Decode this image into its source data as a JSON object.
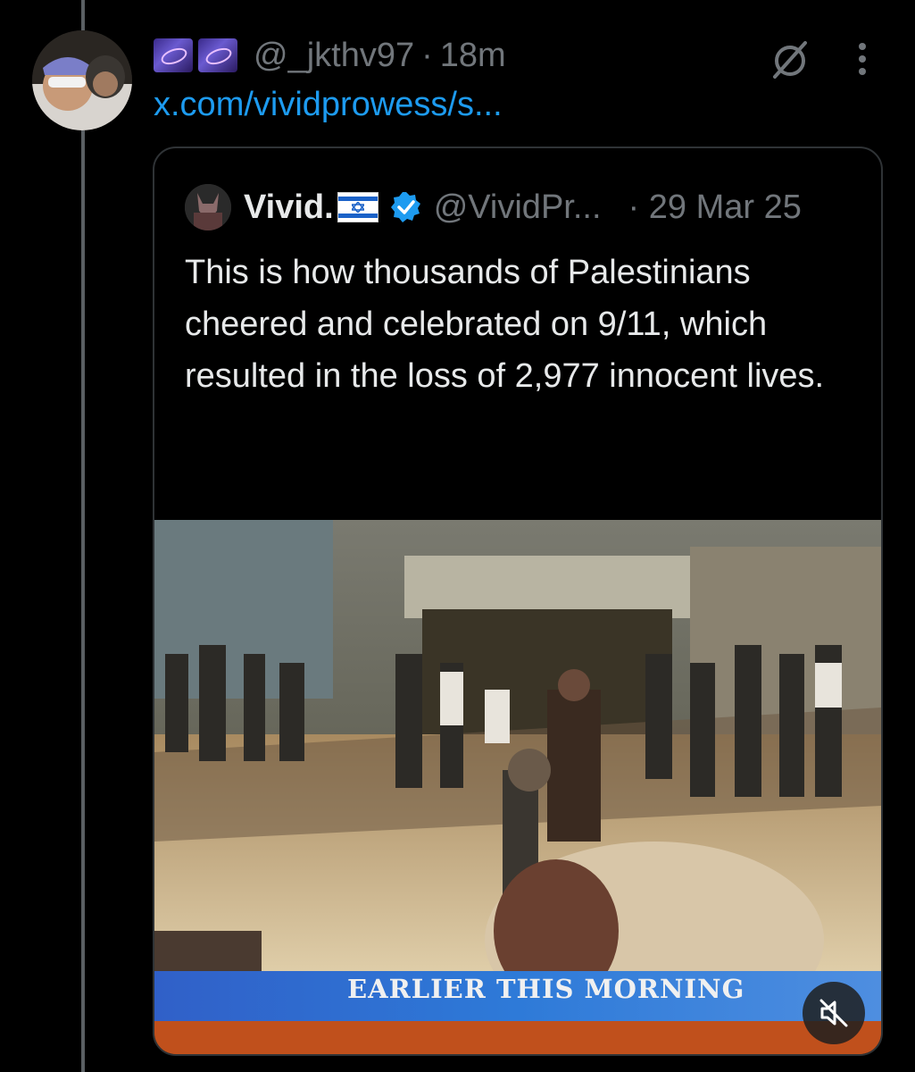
{
  "post": {
    "display_emojis": [
      "milky-way-emoji",
      "milky-way-emoji"
    ],
    "handle": "@_jkthv97",
    "separator": "·",
    "time": "18m",
    "link_text": "x.com/vividprowess/s...",
    "icons": [
      "grok-icon",
      "more-options-icon"
    ]
  },
  "quoted": {
    "name": "Vivid.",
    "flag": "israel-flag",
    "verified": true,
    "handle": "@VividPr...",
    "time": "· 29 Mar 25",
    "text": "This is how thousands of Palestinians cheered and celebrated on 9/11, which resulted in the loss of 2,977 innocent lives.",
    "ellipsis": "...",
    "video": {
      "banner_text": "EARLIER THIS MORNING",
      "muted": true
    }
  },
  "colors": {
    "background": "#000000",
    "text_primary": "#e7e9ea",
    "text_secondary": "#71767b",
    "link": "#1d9bf0",
    "verified": "#1d9bf0",
    "border": "#2f3336"
  }
}
